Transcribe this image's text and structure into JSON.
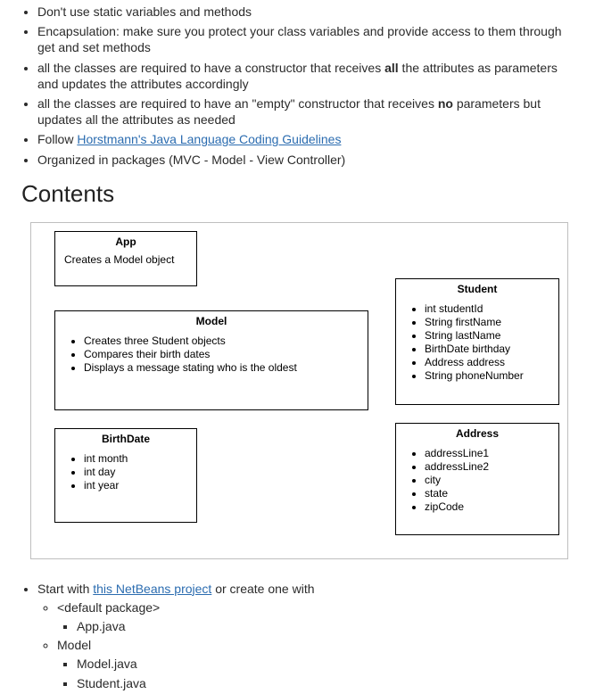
{
  "top_bullets": [
    {
      "pre": "Don't use static variables and methods"
    },
    {
      "pre": "Encapsulation: make sure you protect your class variables and provide access to them through get and set methods"
    },
    {
      "pre": "all the classes are required to have a constructor that receives ",
      "bold": "all",
      "post": " the attributes as parameters and updates the attributes accordingly"
    },
    {
      "pre": "all the classes are required to have an \"empty\" constructor that receives ",
      "bold": "no",
      "post": " parameters but updates all the attributes as needed"
    },
    {
      "pre": "Follow ",
      "link": "Horstmann's Java Language Coding Guidelines"
    },
    {
      "pre": "Organized in packages (MVC - Model - View Controller)"
    }
  ],
  "contents_heading": "Contents",
  "diagram": {
    "app": {
      "title": "App",
      "lines": [
        "Creates a Model object"
      ]
    },
    "model": {
      "title": "Model",
      "lines": [
        "Creates three Student objects",
        "Compares their birth dates",
        "Displays a message stating who is the oldest"
      ]
    },
    "student": {
      "title": "Student",
      "lines": [
        "int studentId",
        "String firstName",
        "String lastName",
        "BirthDate birthday",
        "Address address",
        "String phoneNumber"
      ]
    },
    "birthdate": {
      "title": "BirthDate",
      "lines": [
        "int month",
        "int day",
        "int year"
      ]
    },
    "address": {
      "title": "Address",
      "lines": [
        "addressLine1",
        "addressLine2",
        "city",
        "state",
        "zipCode"
      ]
    }
  },
  "second_section": {
    "intro_pre": "Start with ",
    "intro_link": "this NetBeans project",
    "intro_post": " or create one with",
    "pkg_default": "<default package>",
    "pkg_default_items": [
      "App.java"
    ],
    "pkg_model": "Model",
    "pkg_model_items": [
      "Model.java",
      "Student.java"
    ]
  }
}
